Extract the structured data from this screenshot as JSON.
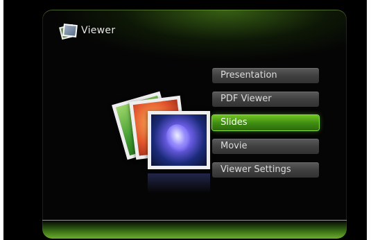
{
  "header": {
    "title": "Viewer",
    "icon": "viewer-photos-icon"
  },
  "menu": {
    "items": [
      {
        "label": "Presentation",
        "selected": false
      },
      {
        "label": "PDF Viewer",
        "selected": false
      },
      {
        "label": "Slides",
        "selected": true
      },
      {
        "label": "Movie",
        "selected": false
      },
      {
        "label": "Viewer Settings",
        "selected": false
      }
    ]
  },
  "theme": {
    "accent": "#3e8a12",
    "background": "#000000",
    "button": "#404040"
  },
  "illustration": {
    "icon": "photo-stack-icon"
  }
}
